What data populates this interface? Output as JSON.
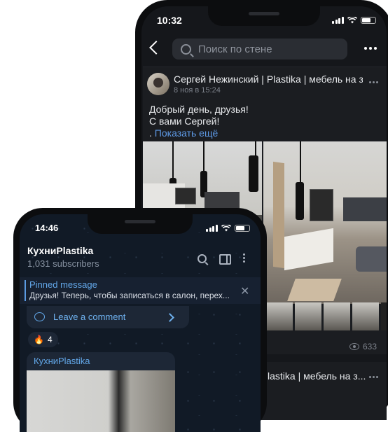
{
  "back_phone": {
    "status_time": "10:32",
    "search_placeholder": "Поиск по стене",
    "post": {
      "author": "Сергей Нежинский | Plastika | мебель на з...",
      "date": "8 ноя в 15:24",
      "text_line1": "Добрый день, друзья!",
      "text_line2": "С вами Сергей!",
      "show_more_prefix": ". ",
      "show_more": "Показать ещё",
      "views": "633"
    },
    "post2": {
      "author_partial": "lastika | мебель на з..."
    }
  },
  "front_phone": {
    "status_time": "14:46",
    "channel_title": "КухниPlastika",
    "subscribers": "1,031 subscribers",
    "pinned_label": "Pinned message",
    "pinned_text": "Друзья! Теперь, чтобы записаться в салон, перех...",
    "leave_comment": "Leave a comment",
    "reaction_emoji": "🔥",
    "reaction_count": "4",
    "message_channel": "КухниPlastika"
  }
}
